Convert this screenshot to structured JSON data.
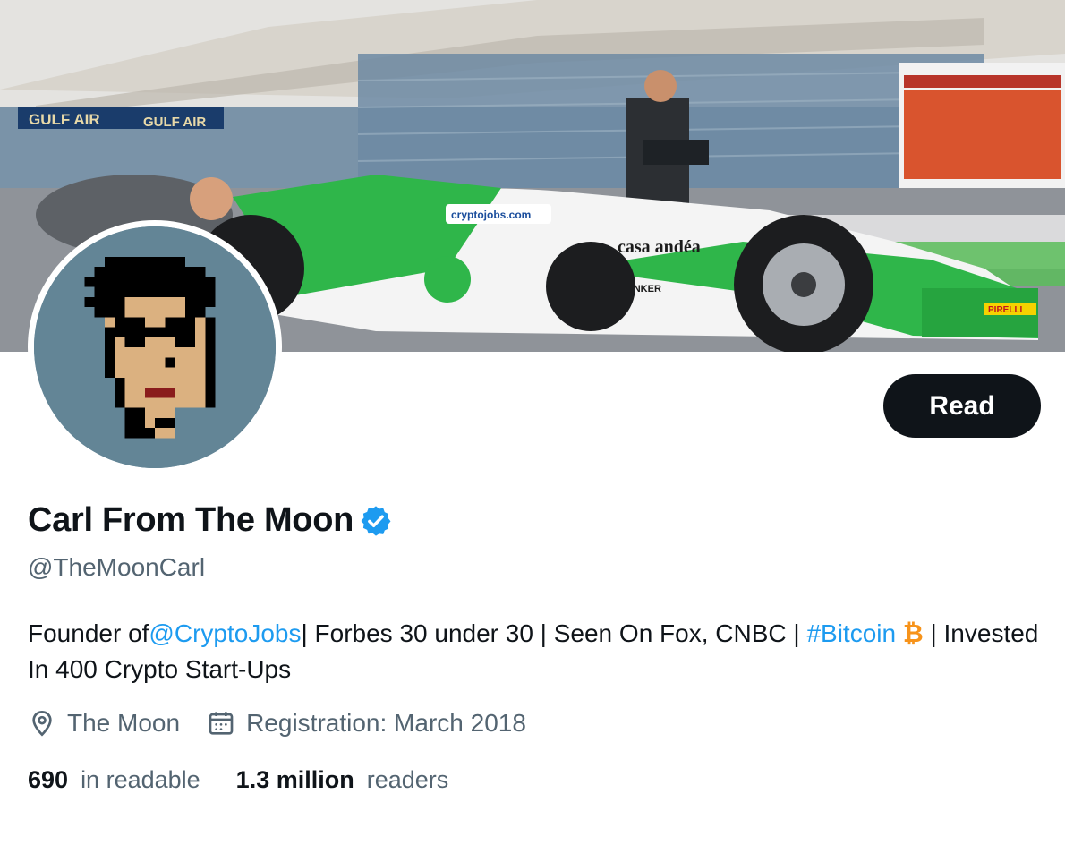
{
  "profile": {
    "display_name": "Carl From The Moon",
    "handle": "@TheMoonCarl",
    "verified_icon": "verified-badge-icon",
    "read_button_label": "Read"
  },
  "bio": {
    "part1": "Founder of",
    "mention": "@CryptoJobs",
    "part2": "| Forbes 30 under 30 | Seen On Fox, CNBC | ",
    "hashtag": "#Bitcoin",
    "btc_symbol": "₿",
    "part3": " | Invested In 400 Crypto Start-Ups"
  },
  "meta": {
    "location": "The Moon",
    "location_icon": "location-pin-icon",
    "registration": "Registration: March 2018",
    "calendar_icon": "calendar-icon"
  },
  "stats": {
    "following_count": "690",
    "following_label": "in readable",
    "followers_count": "1.3 million",
    "followers_label": "readers"
  },
  "banner": {
    "sign_text_1": "GULF AIR",
    "sign_text_2": "GULF AIR",
    "car_sponsor_1": "cryptojobs.com",
    "car_sponsor_2": "casa andéa",
    "car_sponsor_3": "BLINKER",
    "car_sponsor_4": "PIRELLI"
  },
  "colors": {
    "accent": "#1d9bf0",
    "text_primary": "#0f1419",
    "text_secondary": "#536471",
    "button_bg": "#0f1419",
    "bitcoin": "#f7931a",
    "avatar_bg": "#638596"
  }
}
